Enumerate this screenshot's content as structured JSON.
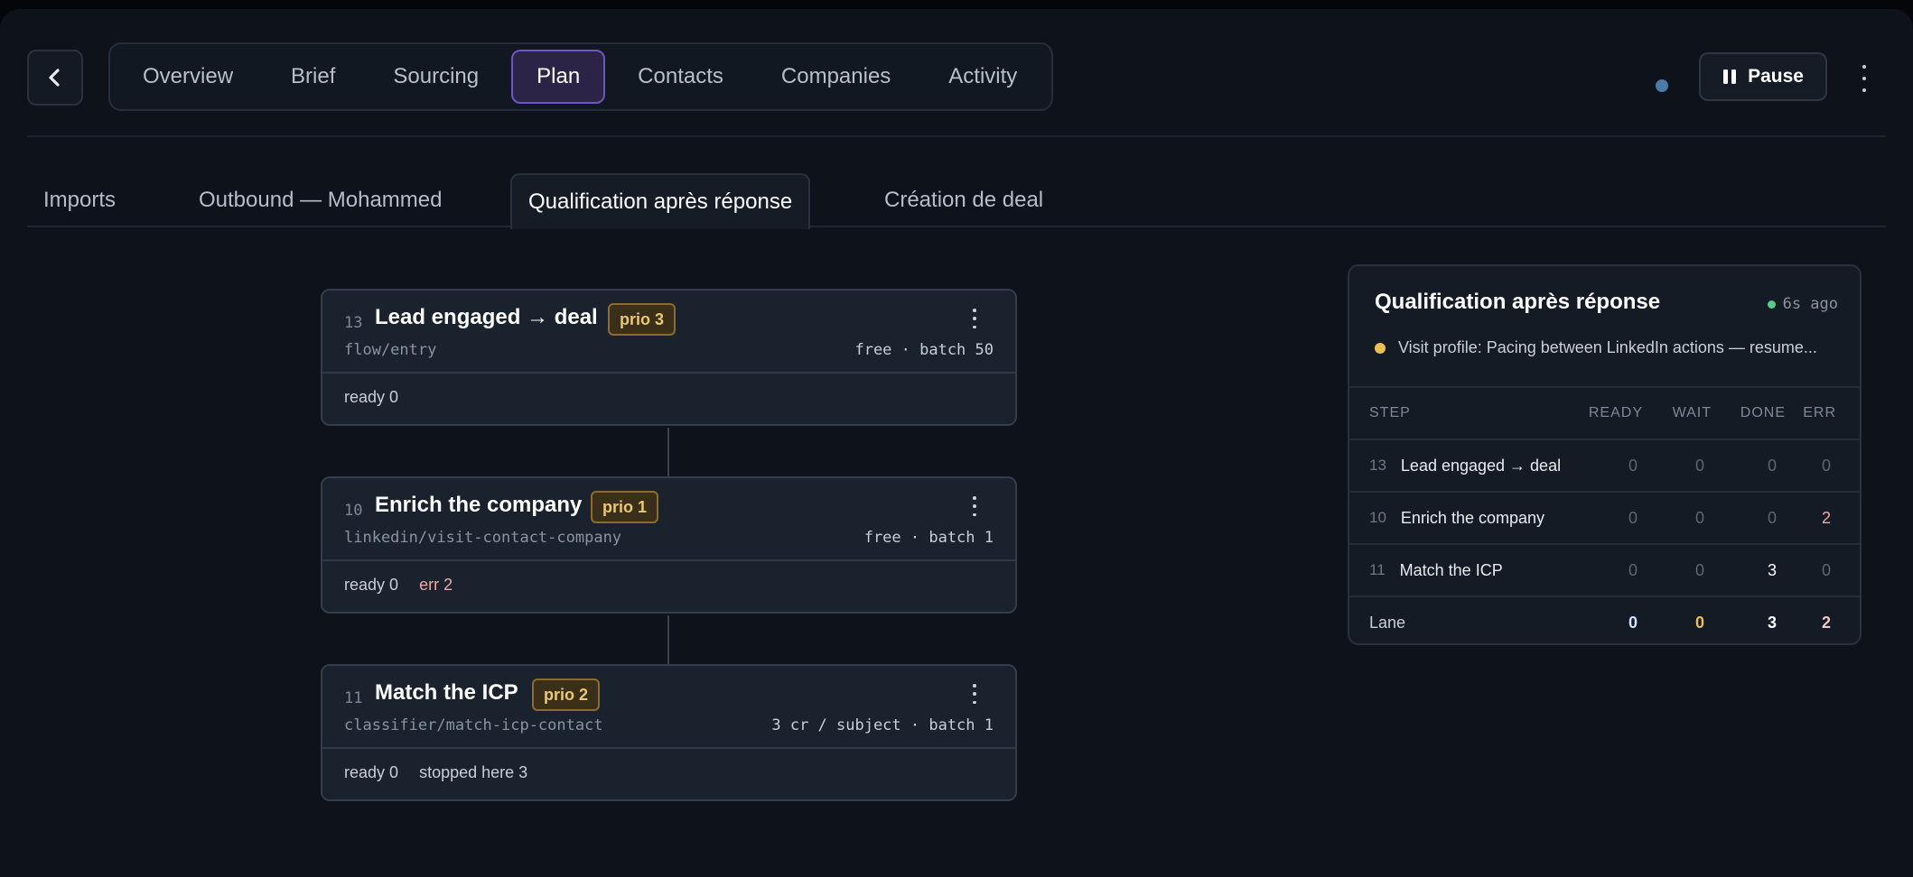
{
  "nav": {
    "back_icon": "chevron-left-icon",
    "tabs": [
      {
        "label": "Overview"
      },
      {
        "label": "Brief"
      },
      {
        "label": "Sourcing"
      },
      {
        "label": "Plan"
      },
      {
        "label": "Contacts"
      },
      {
        "label": "Companies"
      },
      {
        "label": "Activity"
      }
    ],
    "active_tab": "Plan",
    "pause_label": "Pause",
    "status_dot_color": "#4a7aa6"
  },
  "subtabs": {
    "items": [
      {
        "label": "Imports"
      },
      {
        "label": "Outbound — Mohammed"
      },
      {
        "label": "Qualification après réponse"
      },
      {
        "label": "Création de deal"
      }
    ],
    "active": "Qualification après réponse"
  },
  "flow": {
    "steps": [
      {
        "num": "13",
        "title": "Lead engaged → deal",
        "prio": "prio 3",
        "path": "flow/entry",
        "meta": "free · batch 50",
        "ready": "ready 0",
        "extra": ""
      },
      {
        "num": "10",
        "title": "Enrich the company",
        "prio": "prio 1",
        "path": "linkedin/visit-contact-company",
        "meta": "free · batch 1",
        "ready": "ready 0",
        "extra": "err 2"
      },
      {
        "num": "11",
        "title": "Match the ICP",
        "prio": "prio 2",
        "path": "classifier/match-icp-contact",
        "meta": "3 cr / subject · batch 1",
        "ready": "ready 0",
        "extra": "stopped here 3"
      }
    ]
  },
  "panel": {
    "title": "Qualification après réponse",
    "time": "6s ago",
    "message": "Visit profile: Pacing between LinkedIn actions — resume...",
    "headers": {
      "step": "STEP",
      "ready": "READY",
      "wait": "WAIT",
      "done": "DONE",
      "err": "ERR"
    },
    "rows": [
      {
        "num": "13",
        "name": "Lead engaged → deal",
        "ready": "0",
        "wait": "0",
        "done": "0",
        "err": "0"
      },
      {
        "num": "10",
        "name": "Enrich the company",
        "ready": "0",
        "wait": "0",
        "done": "0",
        "err": "2"
      },
      {
        "num": "11",
        "name": "Match the ICP",
        "ready": "0",
        "wait": "0",
        "done": "3",
        "err": "0"
      }
    ],
    "lane": {
      "label": "Lane",
      "ready": "0",
      "wait": "0",
      "done": "3",
      "err": "2"
    },
    "colors": {
      "live": "#4ccf86",
      "warning": "#e9c14c",
      "error": "#f0a8a8"
    }
  }
}
